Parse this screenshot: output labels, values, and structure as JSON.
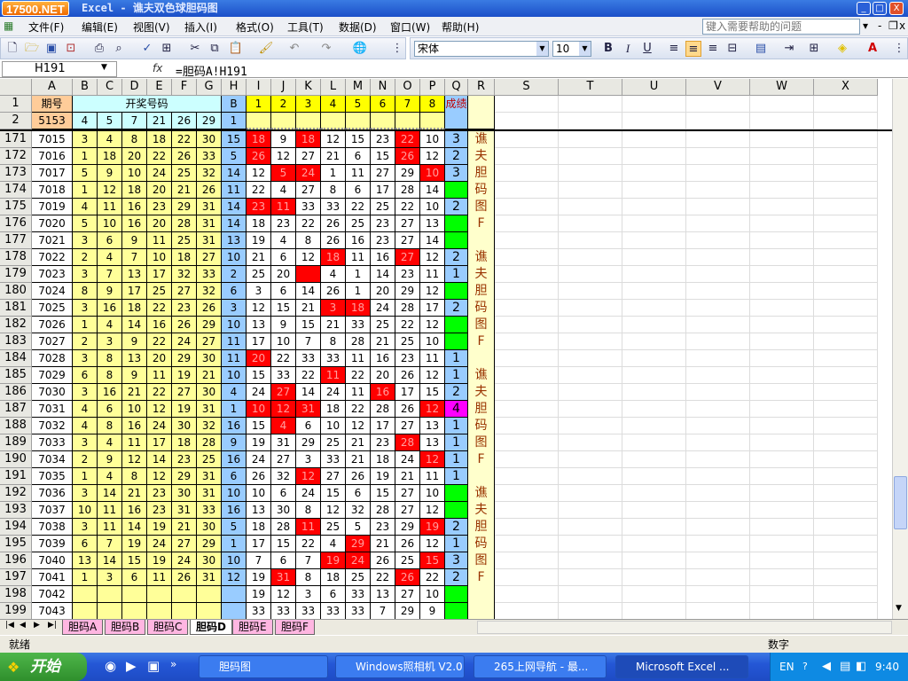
{
  "window": {
    "logo_text": "17500.NET",
    "title": "Excel - 谯夫双色球胆码图",
    "min_label": "_",
    "max_label": "□",
    "close_label": "X"
  },
  "menu": {
    "items": [
      "文件(F)",
      "编辑(E)",
      "视图(V)",
      "插入(I)",
      "格式(O)",
      "工具(T)",
      "数据(D)",
      "窗口(W)",
      "帮助(H)"
    ],
    "help_placeholder": "键入需要帮助的问题",
    "doc_min": "-",
    "doc_max": "❐",
    "doc_close": "x"
  },
  "toolbar": {
    "font_name": "宋体",
    "font_size": "10",
    "bold": "B",
    "italic": "I",
    "underline": "U",
    "font_color_label": "A"
  },
  "formula_bar": {
    "name_box": "H191",
    "fx": "fx",
    "formula": "=胆码A!H191"
  },
  "columns": [
    "A",
    "B",
    "C",
    "D",
    "E",
    "F",
    "G",
    "H",
    "I",
    "J",
    "K",
    "L",
    "M",
    "N",
    "O",
    "P",
    "Q",
    "R",
    "S",
    "T",
    "U",
    "V",
    "W",
    "X"
  ],
  "header_rows": {
    "row1": {
      "label": "1",
      "a": "期号",
      "bg_span": "开奖号码",
      "h": "B",
      "i_to_p": [
        "1",
        "2",
        "3",
        "4",
        "5",
        "6",
        "7",
        "8"
      ],
      "q": "成绩"
    },
    "row2": {
      "label": "2",
      "a": "5153",
      "balls": [
        "4",
        "5",
        "7",
        "21",
        "26",
        "29"
      ],
      "h": "1"
    }
  },
  "rows": [
    {
      "n": "171",
      "a": "7015",
      "balls": [
        "3",
        "4",
        "8",
        "18",
        "22",
        "30"
      ],
      "h": "15",
      "dan": [
        "18",
        "9",
        "18",
        "12",
        "15",
        "23",
        "22",
        "10"
      ],
      "red": [
        0,
        2,
        6
      ],
      "q": "3",
      "qc": "blue"
    },
    {
      "n": "172",
      "a": "7016",
      "balls": [
        "1",
        "18",
        "20",
        "22",
        "26",
        "33"
      ],
      "h": "5",
      "dan": [
        "26",
        "12",
        "27",
        "21",
        "6",
        "15",
        "26",
        "12"
      ],
      "red": [
        0,
        6
      ],
      "q": "2",
      "qc": "blue"
    },
    {
      "n": "173",
      "a": "7017",
      "balls": [
        "5",
        "9",
        "10",
        "24",
        "25",
        "32"
      ],
      "h": "14",
      "dan": [
        "12",
        "5",
        "24",
        "1",
        "11",
        "27",
        "29",
        "10"
      ],
      "red": [
        1,
        2,
        7
      ],
      "q": "3",
      "qc": "blue"
    },
    {
      "n": "174",
      "a": "7018",
      "balls": [
        "1",
        "12",
        "18",
        "20",
        "21",
        "26"
      ],
      "h": "11",
      "dan": [
        "22",
        "4",
        "27",
        "8",
        "6",
        "17",
        "28",
        "14"
      ],
      "red": [],
      "q": "",
      "qc": "green"
    },
    {
      "n": "175",
      "a": "7019",
      "balls": [
        "4",
        "11",
        "16",
        "23",
        "29",
        "31"
      ],
      "h": "14",
      "dan": [
        "23",
        "11",
        "33",
        "33",
        "22",
        "25",
        "22",
        "10"
      ],
      "red": [
        0,
        1
      ],
      "q": "2",
      "qc": "blue"
    },
    {
      "n": "176",
      "a": "7020",
      "balls": [
        "5",
        "10",
        "16",
        "20",
        "28",
        "31"
      ],
      "h": "14",
      "dan": [
        "18",
        "23",
        "22",
        "26",
        "25",
        "23",
        "27",
        "13"
      ],
      "red": [],
      "q": "",
      "qc": "green"
    },
    {
      "n": "177",
      "a": "7021",
      "balls": [
        "3",
        "6",
        "9",
        "11",
        "25",
        "31"
      ],
      "h": "13",
      "dan": [
        "19",
        "4",
        "8",
        "26",
        "16",
        "23",
        "27",
        "14"
      ],
      "red": [],
      "q": "",
      "qc": "green"
    },
    {
      "n": "178",
      "a": "7022",
      "balls": [
        "2",
        "4",
        "7",
        "10",
        "18",
        "27"
      ],
      "h": "10",
      "dan": [
        "21",
        "6",
        "12",
        "18",
        "11",
        "16",
        "27",
        "12"
      ],
      "red": [
        3,
        6
      ],
      "q": "2",
      "qc": "blue"
    },
    {
      "n": "179",
      "a": "7023",
      "balls": [
        "3",
        "7",
        "13",
        "17",
        "32",
        "33"
      ],
      "h": "2",
      "dan": [
        "25",
        "20",
        "",
        "4",
        "1",
        "14",
        "23",
        "11"
      ],
      "red": [
        2
      ],
      "q": "1",
      "qc": "blue"
    },
    {
      "n": "180",
      "a": "7024",
      "balls": [
        "8",
        "9",
        "17",
        "25",
        "27",
        "32"
      ],
      "h": "6",
      "dan": [
        "3",
        "6",
        "14",
        "26",
        "1",
        "20",
        "29",
        "12"
      ],
      "red": [],
      "q": "",
      "qc": "green"
    },
    {
      "n": "181",
      "a": "7025",
      "balls": [
        "3",
        "16",
        "18",
        "22",
        "23",
        "26"
      ],
      "h": "3",
      "dan": [
        "12",
        "15",
        "21",
        "3",
        "18",
        "24",
        "28",
        "17"
      ],
      "red": [
        3,
        4
      ],
      "q": "2",
      "qc": "blue"
    },
    {
      "n": "182",
      "a": "7026",
      "balls": [
        "1",
        "4",
        "14",
        "16",
        "26",
        "29"
      ],
      "h": "10",
      "dan": [
        "13",
        "9",
        "15",
        "21",
        "33",
        "25",
        "22",
        "12"
      ],
      "red": [],
      "q": "",
      "qc": "green"
    },
    {
      "n": "183",
      "a": "7027",
      "balls": [
        "2",
        "3",
        "9",
        "22",
        "24",
        "27"
      ],
      "h": "11",
      "dan": [
        "17",
        "10",
        "7",
        "8",
        "28",
        "21",
        "25",
        "10"
      ],
      "red": [],
      "q": "",
      "qc": "green"
    },
    {
      "n": "184",
      "a": "7028",
      "balls": [
        "3",
        "8",
        "13",
        "20",
        "29",
        "30"
      ],
      "h": "11",
      "dan": [
        "20",
        "22",
        "33",
        "33",
        "11",
        "16",
        "23",
        "11"
      ],
      "red": [
        0
      ],
      "q": "1",
      "qc": "blue"
    },
    {
      "n": "185",
      "a": "7029",
      "balls": [
        "6",
        "8",
        "9",
        "11",
        "19",
        "21"
      ],
      "h": "10",
      "dan": [
        "15",
        "33",
        "22",
        "11",
        "22",
        "20",
        "26",
        "12"
      ],
      "red": [
        3
      ],
      "q": "1",
      "qc": "blue"
    },
    {
      "n": "186",
      "a": "7030",
      "balls": [
        "3",
        "16",
        "21",
        "22",
        "27",
        "30"
      ],
      "h": "4",
      "dan": [
        "24",
        "27",
        "14",
        "24",
        "11",
        "16",
        "17",
        "15"
      ],
      "red": [
        1,
        5
      ],
      "q": "2",
      "qc": "blue"
    },
    {
      "n": "187",
      "a": "7031",
      "balls": [
        "4",
        "6",
        "10",
        "12",
        "19",
        "31"
      ],
      "h": "1",
      "dan": [
        "10",
        "12",
        "31",
        "18",
        "22",
        "28",
        "26",
        "12"
      ],
      "red": [
        0,
        1,
        2,
        7
      ],
      "q": "4",
      "qc": "magenta"
    },
    {
      "n": "188",
      "a": "7032",
      "balls": [
        "4",
        "8",
        "16",
        "24",
        "30",
        "32"
      ],
      "h": "16",
      "dan": [
        "15",
        "4",
        "6",
        "10",
        "12",
        "17",
        "27",
        "13"
      ],
      "red": [
        1
      ],
      "q": "1",
      "qc": "blue"
    },
    {
      "n": "189",
      "a": "7033",
      "balls": [
        "3",
        "4",
        "11",
        "17",
        "18",
        "28"
      ],
      "h": "9",
      "dan": [
        "19",
        "31",
        "29",
        "25",
        "21",
        "23",
        "28",
        "13"
      ],
      "red": [
        6
      ],
      "q": "1",
      "qc": "blue"
    },
    {
      "n": "190",
      "a": "7034",
      "balls": [
        "2",
        "9",
        "12",
        "14",
        "23",
        "25"
      ],
      "h": "16",
      "dan": [
        "24",
        "27",
        "3",
        "33",
        "21",
        "18",
        "24",
        "12"
      ],
      "red": [
        7
      ],
      "q": "1",
      "qc": "blue"
    },
    {
      "n": "191",
      "a": "7035",
      "balls": [
        "1",
        "4",
        "8",
        "12",
        "29",
        "31"
      ],
      "h": "6",
      "dan": [
        "26",
        "32",
        "12",
        "27",
        "26",
        "19",
        "21",
        "11"
      ],
      "red": [
        2
      ],
      "q": "1",
      "qc": "blue"
    },
    {
      "n": "192",
      "a": "7036",
      "balls": [
        "3",
        "14",
        "21",
        "23",
        "30",
        "31"
      ],
      "h": "10",
      "dan": [
        "10",
        "6",
        "24",
        "15",
        "6",
        "15",
        "27",
        "10"
      ],
      "red": [],
      "q": "",
      "qc": "green"
    },
    {
      "n": "193",
      "a": "7037",
      "balls": [
        "10",
        "11",
        "16",
        "23",
        "31",
        "33"
      ],
      "h": "16",
      "dan": [
        "13",
        "30",
        "8",
        "12",
        "32",
        "28",
        "27",
        "12"
      ],
      "red": [],
      "q": "",
      "qc": "green"
    },
    {
      "n": "194",
      "a": "7038",
      "balls": [
        "3",
        "11",
        "14",
        "19",
        "21",
        "30"
      ],
      "h": "5",
      "dan": [
        "18",
        "28",
        "11",
        "25",
        "5",
        "23",
        "29",
        "19"
      ],
      "red": [
        2,
        7
      ],
      "q": "2",
      "qc": "blue"
    },
    {
      "n": "195",
      "a": "7039",
      "balls": [
        "6",
        "7",
        "19",
        "24",
        "27",
        "29"
      ],
      "h": "1",
      "dan": [
        "17",
        "15",
        "22",
        "4",
        "29",
        "21",
        "26",
        "12"
      ],
      "red": [
        4
      ],
      "q": "1",
      "qc": "blue"
    },
    {
      "n": "196",
      "a": "7040",
      "balls": [
        "13",
        "14",
        "15",
        "19",
        "24",
        "30"
      ],
      "h": "10",
      "dan": [
        "7",
        "6",
        "7",
        "19",
        "24",
        "26",
        "25",
        "15"
      ],
      "red": [
        3,
        4,
        7
      ],
      "q": "3",
      "qc": "blue"
    },
    {
      "n": "197",
      "a": "7041",
      "balls": [
        "1",
        "3",
        "6",
        "11",
        "26",
        "31"
      ],
      "h": "12",
      "dan": [
        "19",
        "31",
        "8",
        "18",
        "25",
        "22",
        "26",
        "22"
      ],
      "red": [
        1,
        6
      ],
      "q": "2",
      "qc": "blue"
    },
    {
      "n": "198",
      "a": "7042",
      "balls": [
        "",
        "",
        "",
        "",
        "",
        ""
      ],
      "h": "",
      "dan": [
        "19",
        "12",
        "3",
        "6",
        "33",
        "13",
        "27",
        "10"
      ],
      "red": [],
      "q": "",
      "qc": "green"
    },
    {
      "n": "199",
      "a": "7043",
      "balls": [
        "",
        "",
        "",
        "",
        "",
        ""
      ],
      "h": "",
      "dan": [
        "33",
        "33",
        "33",
        "33",
        "33",
        "7",
        "29",
        "9"
      ],
      "red": [],
      "q": "",
      "qc": "green"
    }
  ],
  "r_column_chars": [
    "谯",
    "夫",
    "胆",
    "码",
    "图",
    "F",
    "",
    "谯",
    "夫",
    "胆",
    "码",
    "图",
    "F",
    "",
    "谯",
    "夫",
    "胆",
    "码",
    "图",
    "F",
    "",
    "谯",
    "夫",
    "胆",
    "码",
    "图",
    "F"
  ],
  "sheet_tabs": [
    "胆码A",
    "胆码B",
    "胆码C",
    "胆码D",
    "胆码E",
    "胆码F"
  ],
  "active_tab": "胆码D",
  "status": {
    "left": "就绪",
    "right": "数字"
  },
  "taskbar": {
    "start_label": "开始",
    "tasks": [
      "胆码图",
      "Windows照相机 V2.0",
      "265上网导航 - 最...",
      "Microsoft Excel ..."
    ],
    "lang": "EN",
    "clock": "9:40"
  },
  "colors": {
    "yellow": "#ffff99",
    "blue": "#99ccff",
    "red": "#ff0000",
    "green": "#00ff00",
    "qblue": "#99ccff",
    "magenta": "#ff00ff",
    "peach": "#ffcc99",
    "r_text": "#993300"
  }
}
